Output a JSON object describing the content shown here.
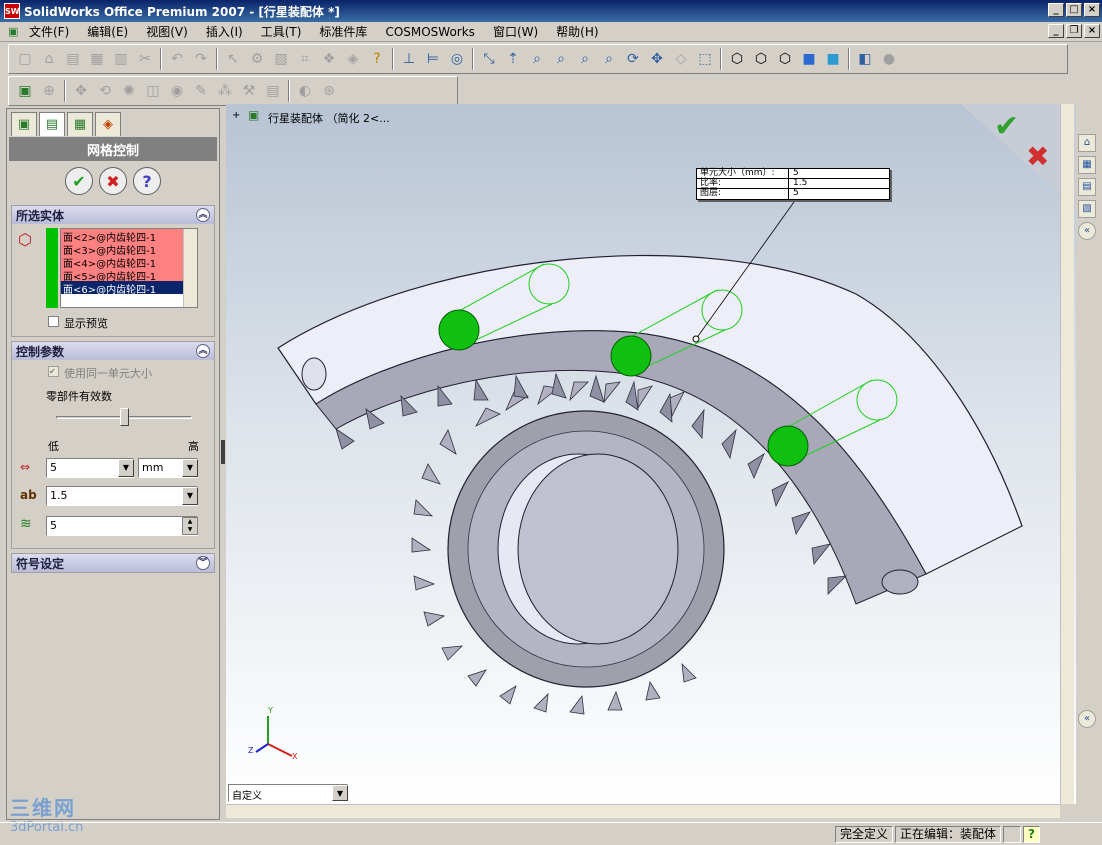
{
  "window": {
    "title": "SolidWorks Office Premium 2007 - [行星装配体 *]",
    "app_icon": "SW"
  },
  "menu": [
    "文件(F)",
    "编辑(E)",
    "视图(V)",
    "插入(I)",
    "工具(T)",
    "标准件库",
    "COSMOSWorks",
    "窗口(W)",
    "帮助(H)"
  ],
  "panel": {
    "title": "网格控制",
    "selected": {
      "header": "所选实体",
      "items": [
        "面<2>@内齿轮四-1",
        "面<3>@内齿轮四-1",
        "面<4>@内齿轮四-1",
        "面<5>@内齿轮四-1",
        "面<6>@内齿轮四-1"
      ],
      "show_preview": "显示预览"
    },
    "params": {
      "header": "控制参数",
      "same_size": "使用同一单元大小",
      "effectiveness": "零部件有效数",
      "low": "低",
      "high": "高",
      "slider_level": 0.5,
      "size_value": "5",
      "unit": "mm",
      "ratio_value": "1.5",
      "layers_value": "5"
    },
    "symbols": {
      "header": "符号设定"
    }
  },
  "viewport": {
    "tree_label": "行星装配体 （简化 2<...",
    "callout": {
      "rows": [
        {
          "label": "单元大小（mm）:",
          "value": "5"
        },
        {
          "label": "比率:",
          "value": "1.5"
        },
        {
          "label": "图层:",
          "value": "5"
        }
      ]
    },
    "triad": {
      "x": "X",
      "y": "Y",
      "z": "Z"
    },
    "view_select": "自定义"
  },
  "watermark": {
    "logo": "三维网",
    "url": "3dPortal.cn"
  },
  "status": {
    "defined": "完全定义",
    "editing": "正在编辑：装配体",
    "help": "?"
  },
  "colors": {
    "title": "#0a246a",
    "accent_green": "#00c000",
    "selection": "#ff8080",
    "mesh": "#20d020"
  }
}
